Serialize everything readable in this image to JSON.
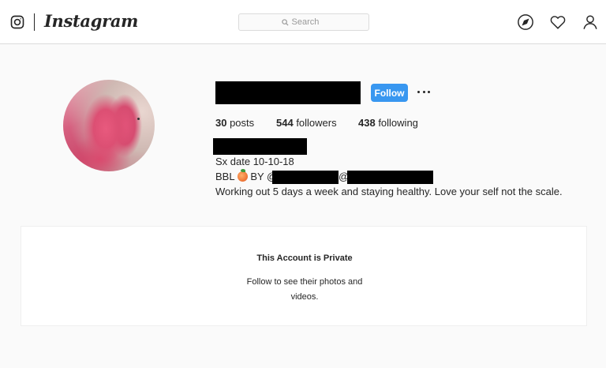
{
  "header": {
    "logo_text": "Instagram",
    "search": {
      "placeholder": "Search"
    },
    "icons": [
      "compass-icon",
      "heart-icon",
      "user-icon"
    ]
  },
  "profile": {
    "follow_label": "Follow",
    "stats": {
      "posts_count": "30",
      "posts_label": " posts",
      "followers_count": "544",
      "followers_label": " followers",
      "following_count": "438",
      "following_label": " following"
    },
    "bio": {
      "line1": "Sx date 10-10-18",
      "line2_prefix": "BBL ",
      "line2_by": " BY @",
      "line2_at": "@",
      "line3": "Working out 5 days a week and staying healthy. Love your self not the scale."
    }
  },
  "private_notice": {
    "title": "This Account is Private",
    "text": "Follow to see their photos and videos."
  },
  "colors": {
    "accent": "#3897f0",
    "background": "#fafafa",
    "border": "#dbdbdb",
    "text": "#262626"
  }
}
